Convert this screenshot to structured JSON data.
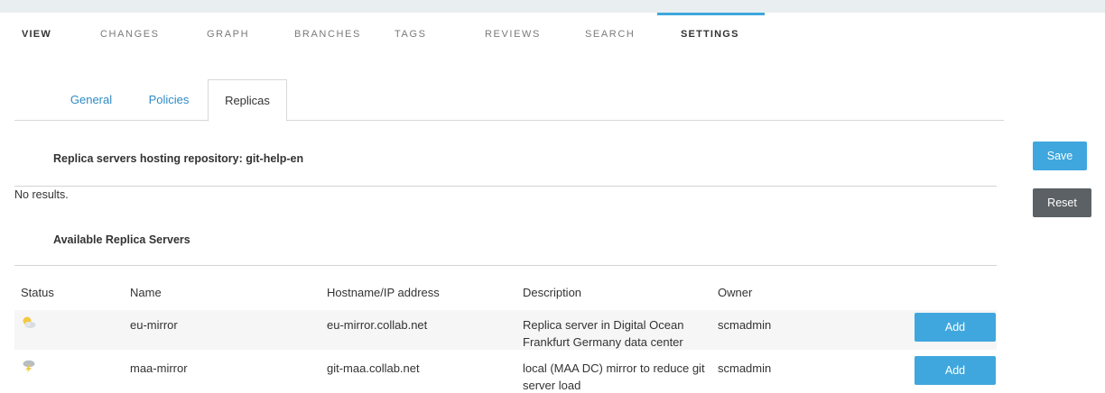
{
  "main_nav": {
    "items": [
      "VIEW",
      "CHANGES",
      "GRAPH",
      "BRANCHES",
      "TAGS",
      "REVIEWS",
      "SEARCH",
      "SETTINGS"
    ],
    "active": "SETTINGS",
    "accent_color": "#3fa7dd"
  },
  "sub_tabs": {
    "items": [
      "General",
      "Policies",
      "Replicas"
    ],
    "active": "Replicas"
  },
  "hosting": {
    "title": "Replica servers hosting repository: git-help-en",
    "empty_text": "No results."
  },
  "actions": {
    "save_label": "Save",
    "reset_label": "Reset"
  },
  "available": {
    "title": "Available Replica Servers",
    "columns": [
      "Status",
      "Name",
      "Hostname/IP address",
      "Description",
      "Owner"
    ],
    "rows": [
      {
        "status_icon": "partly-cloudy-weather-icon",
        "name": "eu-mirror",
        "hostname": "eu-mirror.collab.net",
        "description": "Replica server in Digital Ocean Frankfurt Germany data center",
        "owner": "scmadmin",
        "action_label": "Add"
      },
      {
        "status_icon": "thunderstorm-weather-icon",
        "name": "maa-mirror",
        "hostname": "git-maa.collab.net",
        "description": "local (MAA DC) mirror to reduce git server load",
        "owner": "scmadmin",
        "action_label": "Add"
      }
    ]
  }
}
